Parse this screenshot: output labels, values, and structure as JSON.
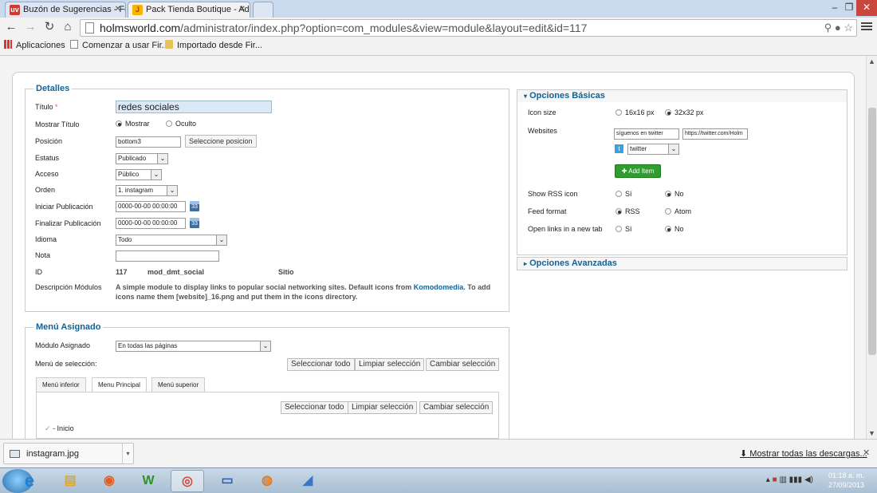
{
  "browser": {
    "tabs": [
      {
        "title": "Buzón de Sugerencias - Fo",
        "favicon": "uservoice-icon",
        "favicon_text": "uv",
        "active": false
      },
      {
        "title": "Pack Tienda Boutique - Ad",
        "favicon": "joomla-icon",
        "favicon_text": "J",
        "active": true
      }
    ],
    "url_host": "holmsworld.com",
    "url_path": "/administrator/index.php?option=com_modules&view=module&layout=edit&id=117",
    "bookmarks": {
      "apps": "Aplicaciones",
      "items": [
        "Comenzar a usar Fir...",
        "Importado desde Fir..."
      ]
    }
  },
  "details": {
    "legend": "Detalles",
    "fields": {
      "titulo_label": "Título",
      "titulo_req": "*",
      "titulo_value": "redes sociales",
      "mostrar_label": "Mostrar Título",
      "mostrar_opt1": "Mostrar",
      "mostrar_opt2": "Oculto",
      "posicion_label": "Posición",
      "posicion_value": "bottom3",
      "posicion_button": "Seleccione posicion",
      "estatus_label": "Estatus",
      "estatus_value": "Publicado",
      "acceso_label": "Acceso",
      "acceso_value": "Público",
      "orden_label": "Orden",
      "orden_value": "1. instagram",
      "iniciar_label": "Iniciar Publicación",
      "iniciar_value": "0000-00-00 00:00:00",
      "finalizar_label": "Finalizar Publicación",
      "finalizar_value": "0000-00-00 00:00:00",
      "idioma_label": "Idioma",
      "idioma_value": "Todo",
      "nota_label": "Nota",
      "nota_value": "",
      "id_label": "ID",
      "id_value": "117",
      "id_module": "mod_dmt_social",
      "id_site": "Sitio",
      "desc_label": "Descripción Módulos",
      "desc_text_1": "A simple module to display links to popular social networking sites. Default icons from ",
      "desc_link": "Komodomedia",
      "desc_text_2": ". To add icons name them [website]_16.png and put them in the icons directory."
    }
  },
  "menu": {
    "legend": "Menú Asignado",
    "modulo_label": "Módulo Asignado",
    "modulo_value": "En todas las páginas",
    "seleccion_label": "Menú de selección:",
    "btn_select_all": "Seleccionar todo",
    "btn_clear": "Limpiar selección",
    "btn_toggle": "Cambiar selección",
    "tabs": [
      "Menú inferior",
      "Menu Principal",
      "Menú superior"
    ],
    "item_inicio": "- Inicio"
  },
  "basic_options": {
    "header": "Opciones Básicas",
    "icon_size_label": "Icon size",
    "icon_size_opt1": "16x16 px",
    "icon_size_opt2": "32x32 px",
    "websites_label": "Websites",
    "website_name": "síguenos en twitter",
    "website_url": "https://twitter.com/Holm",
    "website_type": "twitter",
    "add_item": "Add Item",
    "rss_label": "Show RSS icon",
    "rss_opt1": "Sí",
    "rss_opt2": "No",
    "feed_label": "Feed format",
    "feed_opt1": "RSS",
    "feed_opt2": "Atom",
    "newtab_label": "Open links in a new tab",
    "newtab_opt1": "Sí",
    "newtab_opt2": "No"
  },
  "advanced_options": {
    "header": "Opciones Avanzadas"
  },
  "downloads": {
    "file": "instagram.jpg",
    "show_all": "Mostrar todas las descargas..."
  },
  "taskbar": {
    "time": "01:18 a. m.",
    "date": "27/09/2013"
  }
}
